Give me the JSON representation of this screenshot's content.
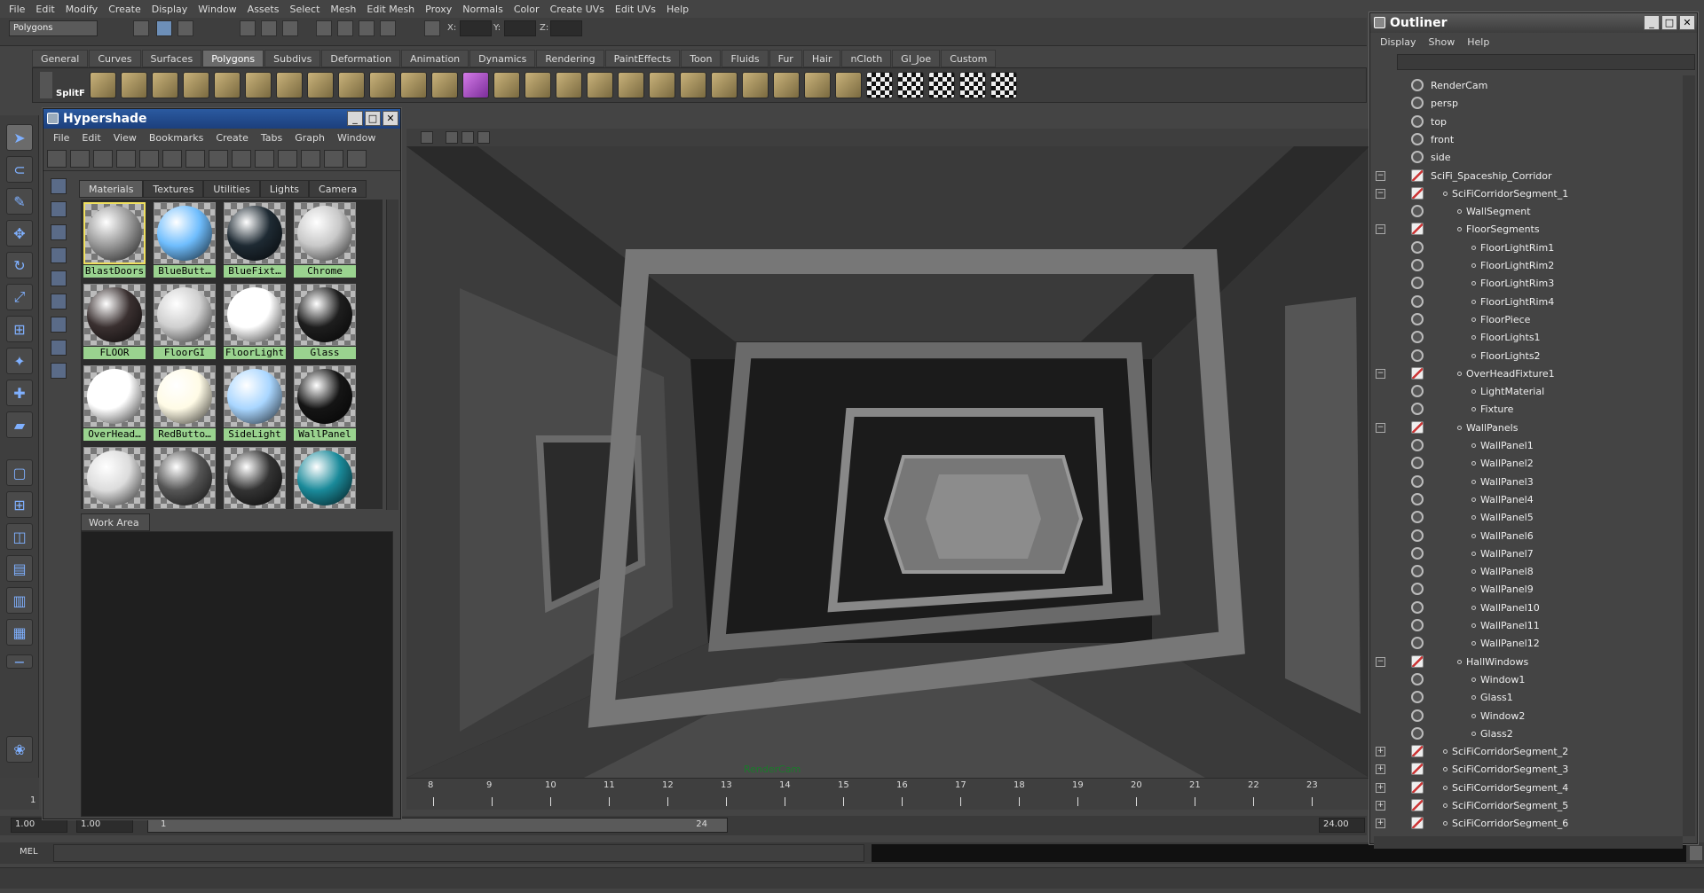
{
  "menubar": [
    "File",
    "Edit",
    "Modify",
    "Create",
    "Display",
    "Window",
    "Assets",
    "Select",
    "Mesh",
    "Edit Mesh",
    "Proxy",
    "Normals",
    "Color",
    "Create UVs",
    "Edit UVs",
    "Help"
  ],
  "status": {
    "mode": "Polygons",
    "x_label": "X:",
    "y_label": "Y:",
    "z_label": "Z:"
  },
  "shelf_tabs": [
    "General",
    "Curves",
    "Surfaces",
    "Polygons",
    "Subdivs",
    "Deformation",
    "Animation",
    "Dynamics",
    "Rendering",
    "PaintEffects",
    "Toon",
    "Fluids",
    "Fur",
    "Hair",
    "nCloth",
    "GI_Joe",
    "Custom"
  ],
  "shelf_active": "Polygons",
  "shelf_first_label": "SplitF",
  "hypershade": {
    "title": "Hypershade",
    "menu": [
      "File",
      "Edit",
      "View",
      "Bookmarks",
      "Create",
      "Tabs",
      "Graph",
      "Window"
    ],
    "tabs": [
      "Materials",
      "Textures",
      "Utilities",
      "Lights",
      "Camera"
    ],
    "active_tab": "Materials",
    "materials": [
      {
        "name": "BlastDoors",
        "color": "#9a9a9a"
      },
      {
        "name": "BlueButt…",
        "color": "#6fbdfd"
      },
      {
        "name": "BlueFixt…",
        "color": "#1e2a33"
      },
      {
        "name": "Chrome",
        "color": "#c8c8c8"
      },
      {
        "name": "FLOOR",
        "color": "#3a3030"
      },
      {
        "name": "FloorGI",
        "color": "#cfcfcf"
      },
      {
        "name": "FloorLight",
        "color": "#ffffff"
      },
      {
        "name": "Glass",
        "color": "#1e1e1e"
      },
      {
        "name": "OverHead…",
        "color": "#ffffff"
      },
      {
        "name": "RedButto…",
        "color": "#fffbe6"
      },
      {
        "name": "SideLight",
        "color": "#a9d6ff"
      },
      {
        "name": "WallPanel",
        "color": "#151515"
      },
      {
        "name": "",
        "color": "#dcdcdc"
      },
      {
        "name": "",
        "color": "#555555"
      },
      {
        "name": "",
        "color": "#333333"
      },
      {
        "name": "",
        "color": "#1a8a9a"
      }
    ],
    "work_area_tab": "Work Area"
  },
  "viewport": {
    "camera_label": "RenderCam"
  },
  "timeline": {
    "ticks": [
      "8",
      "9",
      "10",
      "11",
      "12",
      "13",
      "14",
      "15",
      "16",
      "17",
      "18",
      "19",
      "20",
      "21",
      "22",
      "23"
    ],
    "left_mark": "1"
  },
  "range": {
    "start": "1.00",
    "start2": "1.00",
    "slider_start": "1",
    "slider_end": "24",
    "end": "24.00"
  },
  "mel_label": "MEL",
  "outliner": {
    "title": "Outliner",
    "menu": [
      "Display",
      "Show",
      "Help"
    ],
    "items": [
      {
        "name": "RenderCam",
        "depth": 0,
        "kind": "cam",
        "exp": ""
      },
      {
        "name": "persp",
        "depth": 0,
        "kind": "cam",
        "exp": ""
      },
      {
        "name": "top",
        "depth": 0,
        "kind": "cam",
        "exp": ""
      },
      {
        "name": "front",
        "depth": 0,
        "kind": "cam",
        "exp": ""
      },
      {
        "name": "side",
        "depth": 0,
        "kind": "cam",
        "exp": ""
      },
      {
        "name": "SciFi_Spaceship_Corridor",
        "depth": 0,
        "kind": "grp",
        "exp": "−"
      },
      {
        "name": "SciFiCorridorSegment_1",
        "depth": 1,
        "kind": "grp",
        "exp": "−"
      },
      {
        "name": "WallSegment",
        "depth": 2,
        "kind": "obj",
        "exp": ""
      },
      {
        "name": "FloorSegments",
        "depth": 2,
        "kind": "grp",
        "exp": "−"
      },
      {
        "name": "FloorLightRim1",
        "depth": 3,
        "kind": "obj",
        "exp": ""
      },
      {
        "name": "FloorLightRim2",
        "depth": 3,
        "kind": "obj",
        "exp": ""
      },
      {
        "name": "FloorLightRim3",
        "depth": 3,
        "kind": "obj",
        "exp": ""
      },
      {
        "name": "FloorLightRim4",
        "depth": 3,
        "kind": "obj",
        "exp": ""
      },
      {
        "name": "FloorPiece",
        "depth": 3,
        "kind": "obj",
        "exp": ""
      },
      {
        "name": "FloorLights1",
        "depth": 3,
        "kind": "obj",
        "exp": ""
      },
      {
        "name": "FloorLights2",
        "depth": 3,
        "kind": "obj",
        "exp": ""
      },
      {
        "name": "OverHeadFixture1",
        "depth": 2,
        "kind": "grp",
        "exp": "−"
      },
      {
        "name": "LightMaterial",
        "depth": 3,
        "kind": "obj",
        "exp": ""
      },
      {
        "name": "Fixture",
        "depth": 3,
        "kind": "obj",
        "exp": ""
      },
      {
        "name": "WallPanels",
        "depth": 2,
        "kind": "grp",
        "exp": "−"
      },
      {
        "name": "WallPanel1",
        "depth": 3,
        "kind": "obj",
        "exp": ""
      },
      {
        "name": "WallPanel2",
        "depth": 3,
        "kind": "obj",
        "exp": ""
      },
      {
        "name": "WallPanel3",
        "depth": 3,
        "kind": "obj",
        "exp": ""
      },
      {
        "name": "WallPanel4",
        "depth": 3,
        "kind": "obj",
        "exp": ""
      },
      {
        "name": "WallPanel5",
        "depth": 3,
        "kind": "obj",
        "exp": ""
      },
      {
        "name": "WallPanel6",
        "depth": 3,
        "kind": "obj",
        "exp": ""
      },
      {
        "name": "WallPanel7",
        "depth": 3,
        "kind": "obj",
        "exp": ""
      },
      {
        "name": "WallPanel8",
        "depth": 3,
        "kind": "obj",
        "exp": ""
      },
      {
        "name": "WallPanel9",
        "depth": 3,
        "kind": "obj",
        "exp": ""
      },
      {
        "name": "WallPanel10",
        "depth": 3,
        "kind": "obj",
        "exp": ""
      },
      {
        "name": "WallPanel11",
        "depth": 3,
        "kind": "obj",
        "exp": ""
      },
      {
        "name": "WallPanel12",
        "depth": 3,
        "kind": "obj",
        "exp": ""
      },
      {
        "name": "HallWindows",
        "depth": 2,
        "kind": "grp",
        "exp": "−"
      },
      {
        "name": "Window1",
        "depth": 3,
        "kind": "obj",
        "exp": ""
      },
      {
        "name": "Glass1",
        "depth": 3,
        "kind": "obj",
        "exp": ""
      },
      {
        "name": "Window2",
        "depth": 3,
        "kind": "obj",
        "exp": ""
      },
      {
        "name": "Glass2",
        "depth": 3,
        "kind": "obj",
        "exp": ""
      },
      {
        "name": "SciFiCorridorSegment_2",
        "depth": 1,
        "kind": "grp",
        "exp": "+"
      },
      {
        "name": "SciFiCorridorSegment_3",
        "depth": 1,
        "kind": "grp",
        "exp": "+"
      },
      {
        "name": "SciFiCorridorSegment_4",
        "depth": 1,
        "kind": "grp",
        "exp": "+"
      },
      {
        "name": "SciFiCorridorSegment_5",
        "depth": 1,
        "kind": "grp",
        "exp": "+"
      },
      {
        "name": "SciFiCorridorSegment_6",
        "depth": 1,
        "kind": "grp",
        "exp": "+"
      }
    ]
  }
}
